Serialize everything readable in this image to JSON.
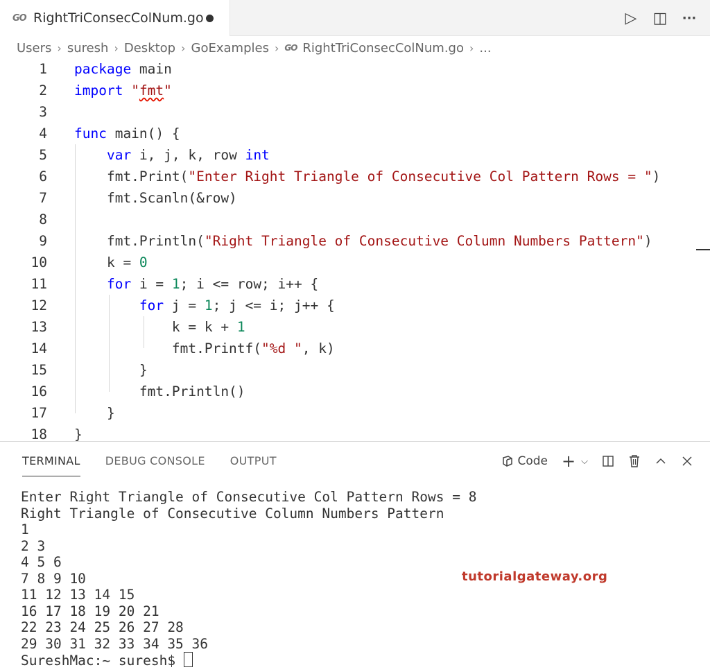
{
  "tab": {
    "icon": "go-file-icon",
    "icon_text": "GO",
    "title": "RightTriConsecColNum.go"
  },
  "tab_actions": [
    {
      "name": "run-icon",
      "glyph": "▷"
    },
    {
      "name": "split-editor-icon",
      "glyph": "◫"
    },
    {
      "name": "more-actions-icon",
      "glyph": "···"
    }
  ],
  "breadcrumb": {
    "items": [
      "Users",
      "suresh",
      "Desktop",
      "GoExamples"
    ],
    "file": "RightTriConsecColNum.go",
    "trailing": "...",
    "separator": "›"
  },
  "editor": {
    "lines": [
      {
        "n": "1",
        "tokens": [
          [
            "kw",
            "package"
          ],
          [
            "",
            "main"
          ]
        ]
      },
      {
        "n": "2",
        "tokens": [
          [
            "kw",
            "import"
          ],
          [
            "str",
            "\"fmt\""
          ]
        ]
      },
      {
        "n": "3",
        "tokens": []
      },
      {
        "n": "4",
        "tokens": [
          [
            "kw",
            "func"
          ],
          [
            "",
            "main() {"
          ]
        ]
      },
      {
        "n": "5",
        "tokens": [
          [
            "",
            "    "
          ],
          [
            "kw",
            "var"
          ],
          [
            "",
            " i, j, k, row "
          ],
          [
            "kw",
            "int"
          ]
        ]
      },
      {
        "n": "6",
        "tokens": [
          [
            "",
            "    fmt.Print("
          ],
          [
            "str",
            "\"Enter Right Triangle of Consecutive Col Pattern Rows = \""
          ],
          [
            "",
            ")"
          ]
        ]
      },
      {
        "n": "7",
        "tokens": [
          [
            "",
            "    fmt.Scanln(&row)"
          ]
        ]
      },
      {
        "n": "8",
        "tokens": []
      },
      {
        "n": "9",
        "tokens": [
          [
            "",
            "    fmt.Println("
          ],
          [
            "str",
            "\"Right Triangle of Consecutive Column Numbers Pattern\""
          ],
          [
            "",
            ")"
          ]
        ]
      },
      {
        "n": "10",
        "tokens": [
          [
            "",
            "    k = "
          ],
          [
            "num",
            "0"
          ]
        ]
      },
      {
        "n": "11",
        "tokens": [
          [
            "",
            "    "
          ],
          [
            "kw",
            "for"
          ],
          [
            "",
            " i = "
          ],
          [
            "num",
            "1"
          ],
          [
            "",
            "; i <= row; i++ {"
          ]
        ]
      },
      {
        "n": "12",
        "tokens": [
          [
            "",
            "        "
          ],
          [
            "kw",
            "for"
          ],
          [
            "",
            " j = "
          ],
          [
            "num",
            "1"
          ],
          [
            "",
            "; j <= i; j++ {"
          ]
        ]
      },
      {
        "n": "13",
        "tokens": [
          [
            "",
            "            k = k + "
          ],
          [
            "num",
            "1"
          ]
        ]
      },
      {
        "n": "14",
        "tokens": [
          [
            "",
            "            fmt.Printf("
          ],
          [
            "str",
            "\"%d \""
          ],
          [
            "",
            ", k)"
          ]
        ]
      },
      {
        "n": "15",
        "tokens": [
          [
            "",
            "        }"
          ]
        ]
      },
      {
        "n": "16",
        "tokens": [
          [
            "",
            "        fmt.Println()"
          ]
        ]
      },
      {
        "n": "17",
        "tokens": [
          [
            "",
            "    }"
          ]
        ]
      },
      {
        "n": "18",
        "tokens": [
          [
            "",
            "}"
          ]
        ]
      }
    ]
  },
  "colors": {
    "keyword": "#0000ff",
    "string": "#a31515",
    "number": "#098658",
    "watermark": "#c0392b"
  },
  "panel": {
    "tabs": [
      "TERMINAL",
      "DEBUG CONSOLE",
      "OUTPUT"
    ],
    "active_tab": "TERMINAL",
    "shell_label": "Code",
    "action_icons": [
      "terminal-shell-icon",
      "new-terminal-icon",
      "dropdown-chevron-icon",
      "split-terminal-icon",
      "trash-icon",
      "maximize-panel-icon",
      "close-panel-icon"
    ]
  },
  "terminal": {
    "lines": [
      "Enter Right Triangle of Consecutive Col Pattern Rows = 8",
      "Right Triangle of Consecutive Column Numbers Pattern",
      "1",
      "2 3",
      "4 5 6",
      "7 8 9 10",
      "11 12 13 14 15",
      "16 17 18 19 20 21",
      "22 23 24 25 26 27 28",
      "29 30 31 32 33 34 35 36"
    ],
    "prompt": "SureshMac:~ suresh$ "
  },
  "watermark": "tutorialgateway.org"
}
